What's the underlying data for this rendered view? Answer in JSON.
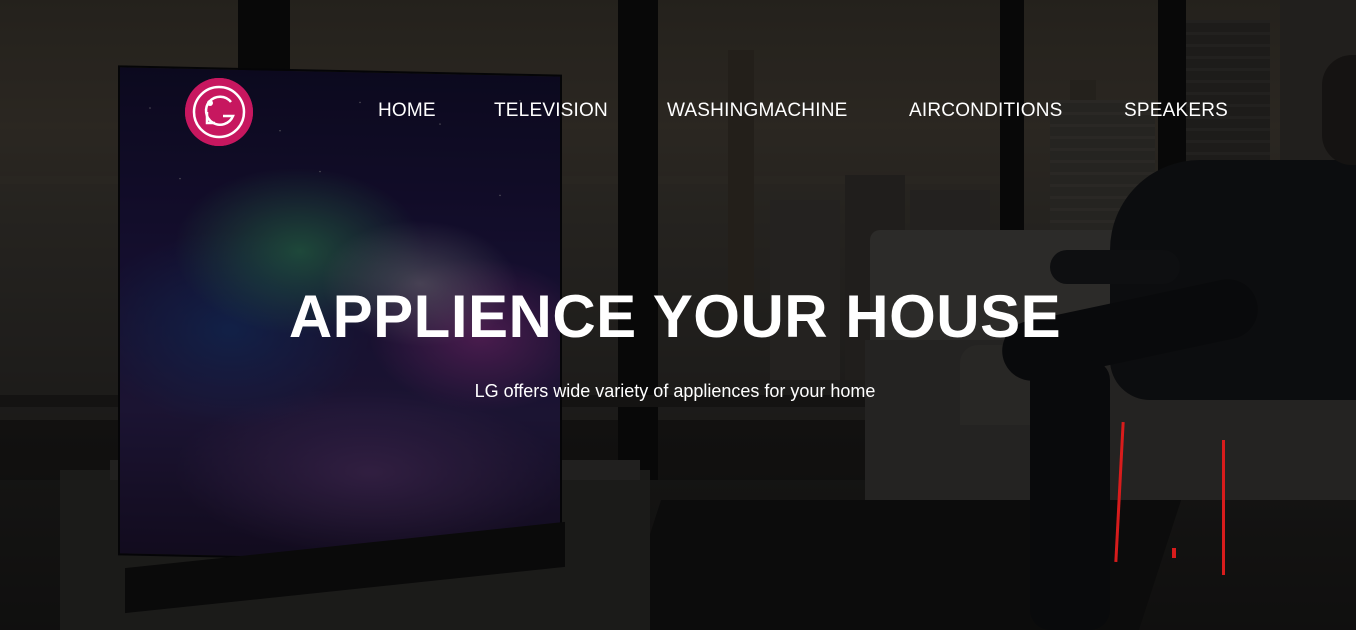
{
  "brand": {
    "logo_text": "LG",
    "logo_color": "#c7175f"
  },
  "nav": {
    "items": [
      {
        "label": "HOME"
      },
      {
        "label": "TELEVISION"
      },
      {
        "label": "WASHINGMACHINE"
      },
      {
        "label": "AIRCONDITIONS"
      },
      {
        "label": "SPEAKERS"
      }
    ]
  },
  "hero": {
    "headline": "APPLIENCE YOUR HOUSE",
    "subheadline": "LG offers wide variety of appliences for your home",
    "text_color": "#ffffff"
  }
}
